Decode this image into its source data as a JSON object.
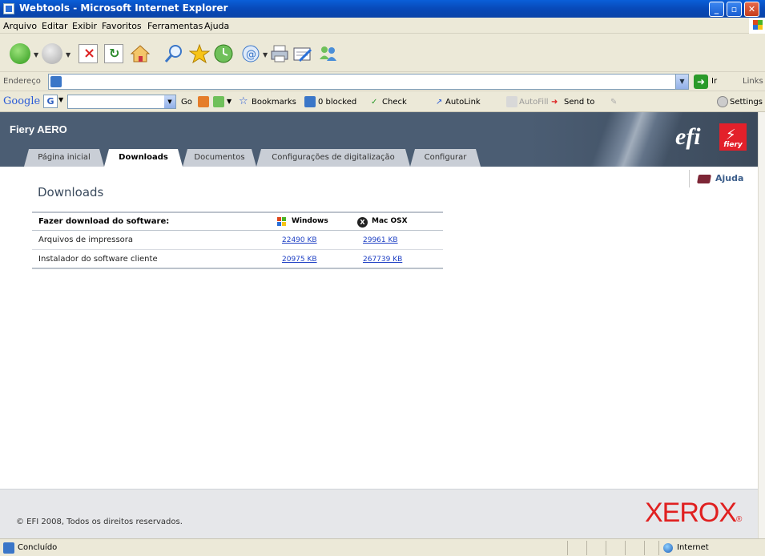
{
  "window": {
    "title": "Webtools - Microsoft Internet Explorer"
  },
  "menu": [
    "Arquivo",
    "Editar",
    "Exibir",
    "Favoritos",
    "Ferramentas",
    "Ajuda"
  ],
  "address": {
    "label": "Endereço",
    "value": "",
    "go_label": "Ir",
    "links_label": "Links"
  },
  "google_toolbar": {
    "logo": "Google",
    "g_button": "G",
    "go": "Go",
    "bookmarks": "Bookmarks",
    "blocked": "0 blocked",
    "check": "Check",
    "autolink": "AutoLink",
    "autofill": "AutoFill",
    "sendto": "Send to",
    "settings": "Settings"
  },
  "header": {
    "app_name": "Fiery AERO",
    "brand": "efi",
    "brand_sub": "fiery"
  },
  "tabs": [
    {
      "label": "Página inicial",
      "active": false
    },
    {
      "label": "Downloads",
      "active": true
    },
    {
      "label": "Documentos",
      "active": false
    },
    {
      "label": "Configurações de digitalização",
      "active": false
    },
    {
      "label": "Configurar",
      "active": false
    }
  ],
  "help_label": "Ajuda",
  "page_title": "Downloads",
  "downloads_table": {
    "header": {
      "title": "Fazer download do software:",
      "windows": "Windows",
      "mac": "Mac OSX"
    },
    "rows": [
      {
        "name": "Arquivos de impressora",
        "windows": "22490 KB",
        "mac": "29961 KB"
      },
      {
        "name": "Instalador do software cliente",
        "windows": "20975 KB",
        "mac": "267739 KB"
      }
    ]
  },
  "footer": {
    "copyright": "© EFI 2008, Todos os direitos reservados.",
    "brand": "XEROX"
  },
  "status": {
    "text": "Concluído",
    "zone": "Internet"
  },
  "colors": {
    "header_bg": "#4b5d73",
    "link": "#1d3fc4",
    "xerox_red": "#e02020",
    "efi_red": "#e3202a"
  }
}
